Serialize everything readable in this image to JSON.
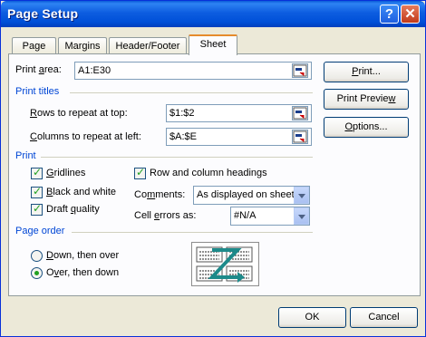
{
  "window": {
    "title": "Page Setup",
    "help_label": "?",
    "close_label": "✕"
  },
  "tabs": [
    {
      "label": "Page"
    },
    {
      "label": "Margins"
    },
    {
      "label": "Header/Footer"
    },
    {
      "label": "Sheet",
      "active": true
    }
  ],
  "print_area": {
    "label_pre": "Print ",
    "label_key": "a",
    "label_post": "rea:",
    "value": "A1:E30"
  },
  "print_titles": {
    "group_label": "Print titles",
    "rows_label_key": "R",
    "rows_label_post": "ows to repeat at top:",
    "rows_value": "$1:$2",
    "cols_label_key": "C",
    "cols_label_post": "olumns to repeat at left:",
    "cols_value": "$A:$E"
  },
  "print": {
    "group_label": "Print",
    "gridlines": {
      "key": "G",
      "post": "ridlines",
      "checked": true
    },
    "black_white": {
      "key": "B",
      "post": "lack and white",
      "checked": true
    },
    "draft": {
      "pre": "Draft ",
      "key": "q",
      "post": "uality",
      "checked": true
    },
    "row_col_headings": {
      "label": "Row and column headings",
      "checked": true
    },
    "comments": {
      "pre": "Co",
      "key": "m",
      "post": "ments:",
      "value": "As displayed on sheet"
    },
    "cell_errors": {
      "pre": "Cell ",
      "key": "e",
      "post": "rrors as:",
      "value": "#N/A"
    }
  },
  "page_order": {
    "group_label": "Page order",
    "down_over": {
      "key": "D",
      "post": "own, then over",
      "selected": false
    },
    "over_down": {
      "pre": "O",
      "key": "v",
      "post": "er, then down",
      "selected": true
    }
  },
  "side_buttons": {
    "print_key": "P",
    "print_post": "rint...",
    "preview_pre": "Print Previe",
    "preview_key": "w",
    "options_key": "O",
    "options_post": "ptions..."
  },
  "footer": {
    "ok": "OK",
    "cancel": "Cancel"
  },
  "colors": {
    "title_bar": "#0050d8",
    "group_label": "#0046d5",
    "check": "#21a121",
    "preview_arrow": "#1d8a8a"
  }
}
